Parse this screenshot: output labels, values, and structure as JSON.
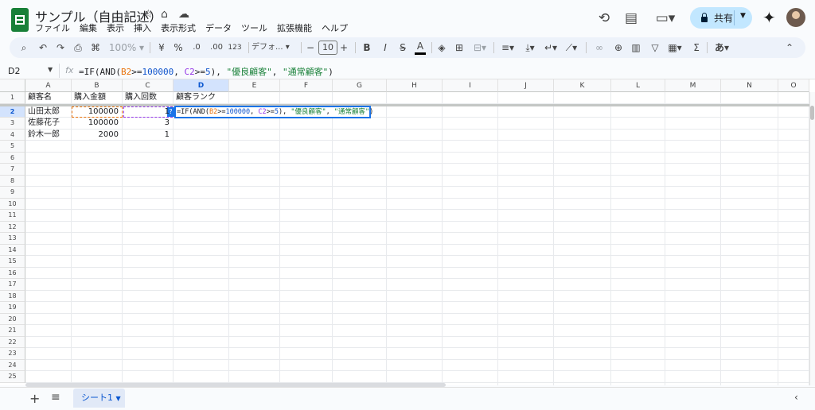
{
  "app": {
    "title": "サンプル（自由記述）",
    "menu": [
      "ファイル",
      "編集",
      "表示",
      "挿入",
      "表示形式",
      "データ",
      "ツール",
      "拡張機能",
      "ヘルプ"
    ],
    "share_label": "共有"
  },
  "toolbar": {
    "zoom": "100%",
    "currency": "¥",
    "percent": "%",
    "dec_less": ".0",
    "dec_more": ".00",
    "num_format": "123",
    "font": "デフォ...",
    "minus": "−",
    "font_size": "10",
    "plus": "+",
    "bold": "B",
    "italic": "I",
    "strike": "S",
    "textcolor": "A",
    "ime": "あ"
  },
  "formula_bar": {
    "cell_ref": "D2",
    "fx": "fx",
    "parts": [
      "=IF(AND(",
      "B2",
      ">=",
      "100000",
      ", ",
      "C2",
      ">=",
      "5",
      "), ",
      "\"優良顧客\"",
      ", ",
      "\"通常顧客\"",
      ")"
    ]
  },
  "grid": {
    "columns": [
      "A",
      "B",
      "C",
      "D",
      "E",
      "F",
      "G",
      "H",
      "I",
      "J",
      "K",
      "L",
      "M",
      "N",
      "O"
    ],
    "selected_column": "D",
    "row_count": 25,
    "selected_row": 2,
    "cells": [
      {
        "col": "A",
        "row": 1,
        "value": "顧客名"
      },
      {
        "col": "B",
        "row": 1,
        "value": "購入金額"
      },
      {
        "col": "C",
        "row": 1,
        "value": "購入回数"
      },
      {
        "col": "D",
        "row": 1,
        "value": "顧客ランク"
      },
      {
        "col": "A",
        "row": 2,
        "value": "山田太郎"
      },
      {
        "col": "B",
        "row": 2,
        "value": "100000",
        "numeric": true
      },
      {
        "col": "C",
        "row": 2,
        "value": "1",
        "numeric": true
      },
      {
        "col": "A",
        "row": 3,
        "value": "佐藤花子"
      },
      {
        "col": "B",
        "row": 3,
        "value": "100000",
        "numeric": true
      },
      {
        "col": "C",
        "row": 3,
        "value": "3",
        "numeric": true
      },
      {
        "col": "A",
        "row": 4,
        "value": "鈴木一郎"
      },
      {
        "col": "B",
        "row": 4,
        "value": "2000",
        "numeric": true
      },
      {
        "col": "C",
        "row": 4,
        "value": "1",
        "numeric": true
      }
    ],
    "help_badge": "?"
  },
  "sheets": {
    "tabs": [
      "シート1"
    ],
    "active": "シート1"
  }
}
